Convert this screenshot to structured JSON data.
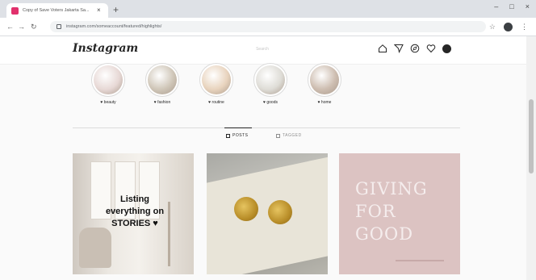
{
  "browser": {
    "tab_title": "Copy of Save Voters Jakarta Sa...",
    "tab_close": "×",
    "new_tab": "+",
    "url": "instagram.com/someaccount/featured/highlights/",
    "window_controls": [
      "–",
      "□",
      "×"
    ]
  },
  "instagram": {
    "logo": "Instagram",
    "search_placeholder": "Search",
    "nav_icons": [
      "home-icon",
      "direct-icon",
      "explore-icon",
      "heart-icon",
      "profile-avatar"
    ],
    "highlights": [
      {
        "label": "♥ beauty",
        "color": "#e7d8d5"
      },
      {
        "label": "♥ fashion",
        "color": "#cfc6b8"
      },
      {
        "label": "♥ routine",
        "color": "#e8d3bd"
      },
      {
        "label": "♥ goods",
        "color": "#dedcd6"
      },
      {
        "label": "♥ home",
        "color": "#cdbdb0"
      }
    ],
    "tabs": [
      {
        "label": "POSTS",
        "active": true
      },
      {
        "label": "TAGGED",
        "active": false
      }
    ],
    "posts": [
      {
        "text_lines": [
          "Listing",
          "everything on",
          "STORIES ♥"
        ]
      },
      {
        "text_lines": []
      },
      {
        "text_lines": [
          "GIVING",
          "FOR",
          "GOOD"
        ]
      }
    ]
  }
}
